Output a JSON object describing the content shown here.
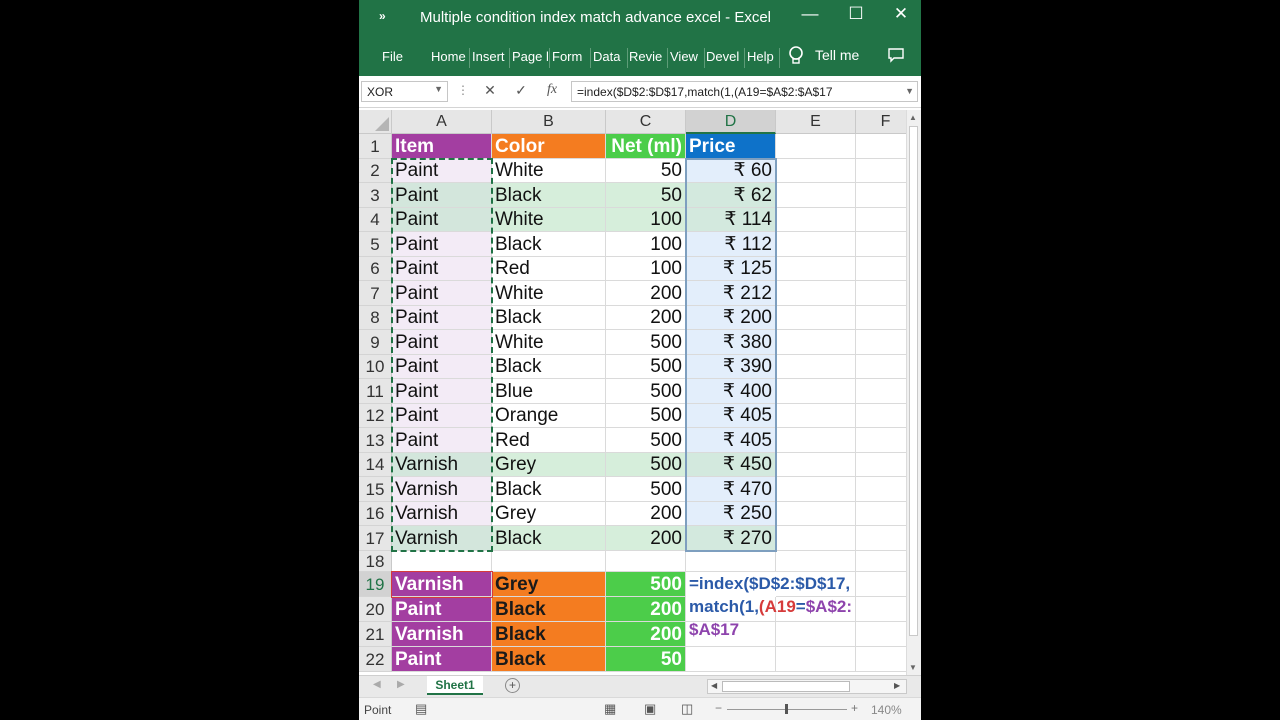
{
  "window": {
    "qat_label": "»",
    "title": "Multiple condition index match advance excel  -  Excel",
    "minimize_icon": "—",
    "maximize_icon": "☐",
    "close_icon": "✕"
  },
  "ribbon": {
    "tabs": [
      "File",
      "Home",
      "Insert",
      "Page l",
      "Form",
      "Data",
      "Revie",
      "View",
      "Devel",
      "Help"
    ],
    "tell_me": "Tell me",
    "tell_me_icon": "lightbulb-icon",
    "comments_icon": "comment-icon"
  },
  "formula_bar": {
    "name_box": "XOR",
    "cancel_icon": "✕",
    "enter_icon": "✓",
    "fx_icon": "fx",
    "formula": "=index($D$2:$D$17,match(1,(A19=$A$2:$A$17"
  },
  "columns": [
    "A",
    "B",
    "C",
    "D",
    "E",
    "F"
  ],
  "rows": [
    "1",
    "2",
    "3",
    "4",
    "5",
    "6",
    "7",
    "8",
    "9",
    "10",
    "11",
    "12",
    "13",
    "14",
    "15",
    "16",
    "17",
    "18",
    "19",
    "20",
    "21",
    "22"
  ],
  "header_row": {
    "item": "Item",
    "color": "Color",
    "net": "Net (ml)",
    "price": "Price"
  },
  "table": [
    {
      "item": "Paint",
      "color": "White",
      "net": "50",
      "price": "₹ 60"
    },
    {
      "item": "Paint",
      "color": "Black",
      "net": "50",
      "price": "₹ 62"
    },
    {
      "item": "Paint",
      "color": "White",
      "net": "100",
      "price": "₹ 114"
    },
    {
      "item": "Paint",
      "color": "Black",
      "net": "100",
      "price": "₹ 112"
    },
    {
      "item": "Paint",
      "color": "Red",
      "net": "100",
      "price": "₹ 125"
    },
    {
      "item": "Paint",
      "color": "White",
      "net": "200",
      "price": "₹ 212"
    },
    {
      "item": "Paint",
      "color": "Black",
      "net": "200",
      "price": "₹ 200"
    },
    {
      "item": "Paint",
      "color": "White",
      "net": "500",
      "price": "₹ 380"
    },
    {
      "item": "Paint",
      "color": "Black",
      "net": "500",
      "price": "₹ 390"
    },
    {
      "item": "Paint",
      "color": "Blue",
      "net": "500",
      "price": "₹ 400"
    },
    {
      "item": "Paint",
      "color": "Orange",
      "net": "500",
      "price": "₹ 405"
    },
    {
      "item": "Paint",
      "color": "Red",
      "net": "500",
      "price": "₹ 405"
    },
    {
      "item": "Varnish",
      "color": "Grey",
      "net": "500",
      "price": "₹ 450"
    },
    {
      "item": "Varnish",
      "color": "Black",
      "net": "500",
      "price": "₹ 470"
    },
    {
      "item": "Varnish",
      "color": "Grey",
      "net": "200",
      "price": "₹ 250"
    },
    {
      "item": "Varnish",
      "color": "Black",
      "net": "200",
      "price": "₹ 270"
    }
  ],
  "lookup": [
    {
      "item": "Varnish",
      "color": "Grey",
      "net": "500"
    },
    {
      "item": "Paint",
      "color": "Black",
      "net": "200"
    },
    {
      "item": "Varnish",
      "color": "Black",
      "net": "200"
    },
    {
      "item": "Paint",
      "color": "Black",
      "net": "50"
    }
  ],
  "formula_in_cell": {
    "p1": "=index(",
    "p2": "$D$2:$D$17",
    "p3": ",",
    "p4": "match(",
    "p5": "1,",
    "p6": "(A19",
    "p7": "=",
    "p8": "$A$2:",
    "p9": "$A$17"
  },
  "sheet_tabs": [
    "Sheet1"
  ],
  "add_sheet_icon": "+",
  "status": {
    "mode": "Point",
    "zoom": "140%",
    "zoom_minus": "−",
    "zoom_plus": "+"
  },
  "colors": {
    "excel_green": "#217346",
    "item_header": "#a33ea1",
    "color_header": "#f47c20",
    "net_header": "#4ccd4a",
    "price_header": "#0e72c9",
    "green_band": "#d6eedb",
    "lavender_band": "#f3ebf6",
    "price_band": "#e3eefb",
    "formula_blue": "#2b5aa8",
    "formula_red": "#d63b3b",
    "formula_purple": "#8e44ad"
  }
}
